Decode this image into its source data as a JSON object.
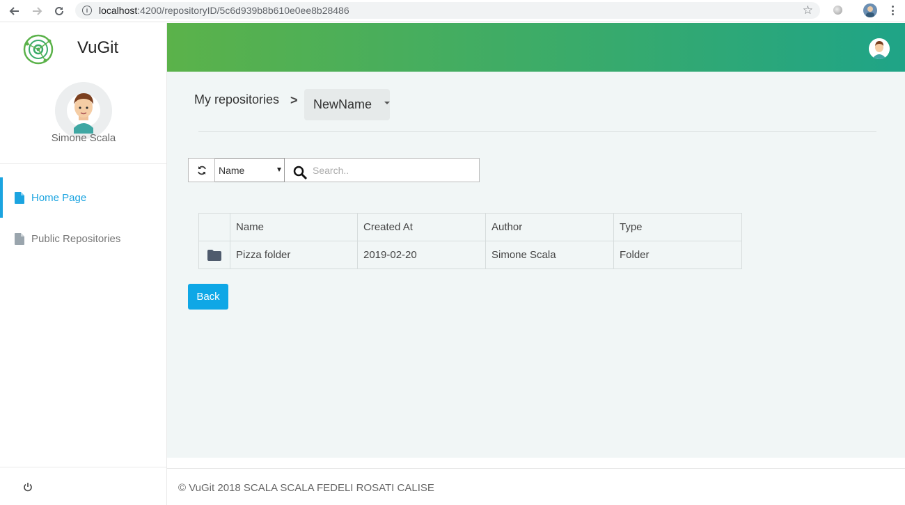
{
  "browser": {
    "url_host": "localhost",
    "url_path": ":4200/repositoryID/5c6d939b8b610e0ee8b28486"
  },
  "sidebar": {
    "brand": "VuGit",
    "user_name": "Simone Scala",
    "items": [
      {
        "label": "Home Page",
        "active": true
      },
      {
        "label": "Public Repositories",
        "active": false
      }
    ]
  },
  "breadcrumb": {
    "root": "My repositories",
    "separator": ">",
    "current": "NewName"
  },
  "toolbar": {
    "field_selected": "Name",
    "search_placeholder": "Search.."
  },
  "table": {
    "headers": [
      "Name",
      "Created At",
      "Author",
      "Type"
    ],
    "rows": [
      {
        "icon": "folder-icon",
        "name": "Pizza folder",
        "created_at": "2019-02-20",
        "author": "Simone Scala",
        "type": "Folder"
      }
    ]
  },
  "back_label": "Back",
  "footer": "© VuGit 2018 SCALA SCALA FEDELI ROSATI CALISE",
  "colors": {
    "accent": "#1ba4e0",
    "header_start": "#5bb24a",
    "header_end": "#1fa487",
    "button": "#0ea7e6"
  }
}
